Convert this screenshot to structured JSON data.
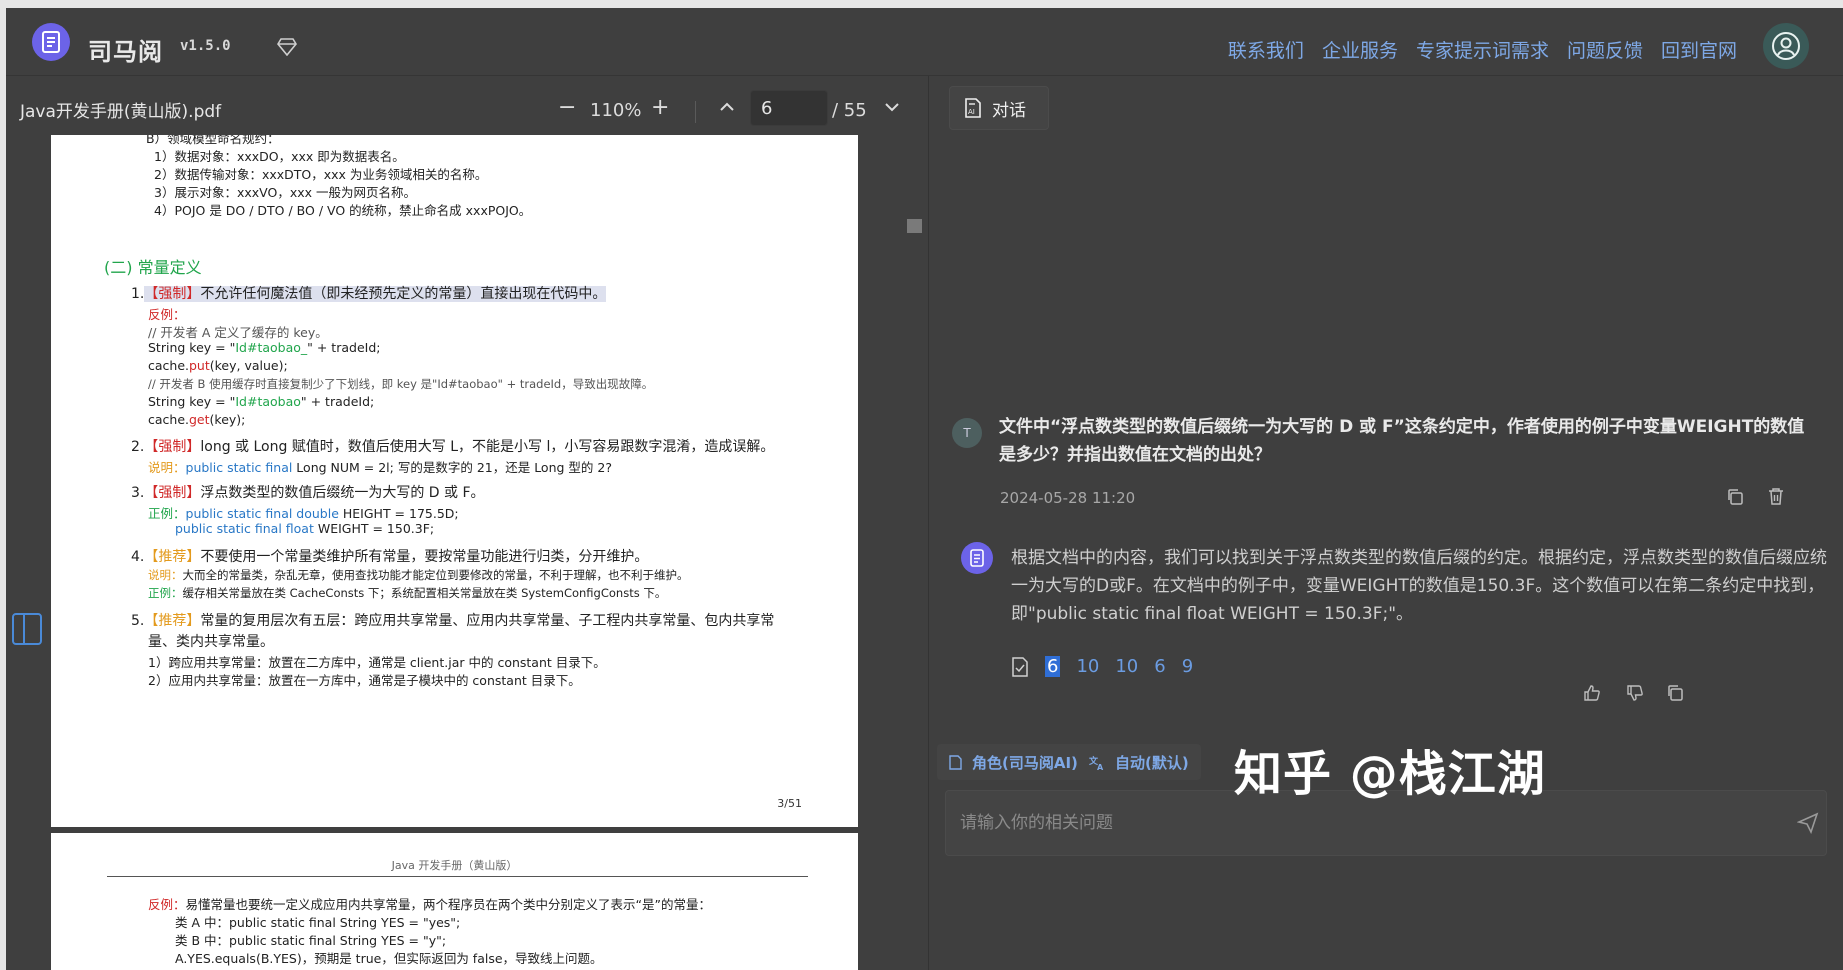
{
  "header": {
    "app_name": "司马阅",
    "version": "v1.5.0",
    "nav": [
      "联系我们",
      "企业服务",
      "专家提示词需求",
      "问题反馈",
      "回到官网"
    ]
  },
  "pdf": {
    "filename": "Java开发手册(黄山版).pdf",
    "zoom": "110%",
    "current_page": "6",
    "total_pages": "/ 55",
    "page1": {
      "lines": [
        "B）领域模型命名规约：",
        "1）数据对象：xxxDO，xxx 即为数据表名。",
        "2）数据传输对象：xxxDTO，xxx 为业务领域相关的名称。",
        "3）展示对象：xxxVO，xxx 一般为网页名称。",
        "4）POJO 是 DO / DTO / BO / VO 的统称，禁止命名成 xxxPOJO。"
      ],
      "section_title": "(二) 常量定义",
      "rule1_num": "1.",
      "rule1_tag": "【强制】",
      "rule1_text": "不允许任何魔法值（即未经预先定义的常量）直接出现在代码中。",
      "counter_label": "反例：",
      "code1": "// 开发者 A 定义了缓存的 key。",
      "code2_pre": "String key = \"",
      "code2_str": "Id#taobao_",
      "code2_post": "\" + tradeId;",
      "code3_pre": "cache.",
      "code3_kw": "put",
      "code3_post": "(key, value);",
      "code4": "// 开发者 B 使用缓存时直接复制少了下划线，即 key 是\"Id#taobao\" + tradeId，导致出现故障。",
      "code5_pre": "String key = \"",
      "code5_str": "Id#taobao",
      "code5_post": "\" + tradeId;",
      "code6_pre": "cache.",
      "code6_kw": "get",
      "code6_post": "(key);",
      "rule2_num": "2.",
      "rule2_tag": "【强制】",
      "rule2_text": "long 或 Long 赋值时，数值后使用大写 L，不能是小写 l，小写容易跟数字混淆，造成误解。",
      "rule2_note_label": "说明：",
      "rule2_note_kw": "public static final",
      "rule2_note_text": " Long NUM = 2l; 写的是数字的 21，还是 Long 型的 2?",
      "rule3_num": "3.",
      "rule3_tag": "【强制】",
      "rule3_text": "浮点数类型的数值后缀统一为大写的 D 或 F。",
      "rule3_ex_label": "正例：",
      "rule3_ex1_kw": "public static final double",
      "rule3_ex1_text": " HEIGHT = 175.5D;",
      "rule3_ex2_kw": "public static final float",
      "rule3_ex2_text": " WEIGHT = 150.3F;",
      "rule4_num": "4.",
      "rule4_tag": "【推荐】",
      "rule4_text": "不要使用一个常量类维护所有常量，要按常量功能进行归类，分开维护。",
      "rule4_note_label": "说明：",
      "rule4_note": "大而全的常量类，杂乱无章，使用查找功能才能定位到要修改的常量，不利于理解，也不利于维护。",
      "rule4_ex_label": "正例：",
      "rule4_ex": "缓存相关常量放在类 CacheConsts 下；系统配置相关常量放在类 SystemConfigConsts 下。",
      "rule5_num": "5.",
      "rule5_tag": "【推荐】",
      "rule5_text": "常量的复用层次有五层：跨应用共享常量、应用内共享常量、子工程内共享常量、包内共享常",
      "rule5_text2": "量、类内共享常量。",
      "rule5_item1": "1）跨应用共享常量：放置在二方库中，通常是 client.jar 中的 constant 目录下。",
      "rule5_item2": "2）应用内共享常量：放置在一方库中，通常是子模块中的 constant 目录下。",
      "page_number": "3/51"
    },
    "page2": {
      "header": "Java 开发手册（黄山版）",
      "counter_label": "反例：",
      "counter_text": "易懂常量也要统一定义成应用内共享常量，两个程序员在两个类中分别定义了表示“是”的常量：",
      "line1": "类 A 中：public static final String YES = \"yes\";",
      "line2": "类 B 中：public static final String YES = \"y\";",
      "line3": "A.YES.equals(B.YES)，预期是 true，但实际返回为 false，导致线上问题。"
    }
  },
  "chat": {
    "tab_label": "对话",
    "question_avatar": "T",
    "question": "文件中“浮点数类型的数值后缀统一为大写的 D 或 F”这条约定中，作者使用的例子中变量WEIGHT的数值是多少？并指出数值在文档的出处？",
    "question_time": "2024-05-28 11:20",
    "answer": "根据文档中的内容，我们可以找到关于浮点数类型的数值后缀的约定。根据约定，浮点数类型的数值后缀应统一为大写的D或F。在文档中的例子中，变量WEIGHT的数值是150.3F。这个数值可以在第二条约定中找到，即\"public static final float WEIGHT = 150.3F;\"。",
    "refs": [
      "6",
      "10",
      "10",
      "6",
      "9"
    ],
    "role_chip": "角色(司马阅AI)",
    "lang_chip": "自动(默认)",
    "input_placeholder": "请输入你的相关问题"
  },
  "watermark": "知乎 @栈江湖",
  "colors": {
    "accent": "#6c63e8",
    "link": "#7ea8e6",
    "background": "#3f3f3f"
  },
  "icons": {
    "logo": "document-icon",
    "vip": "diamond-icon",
    "avatar": "user-circle-icon",
    "sidebar": "sidebar-toggle-icon"
  }
}
